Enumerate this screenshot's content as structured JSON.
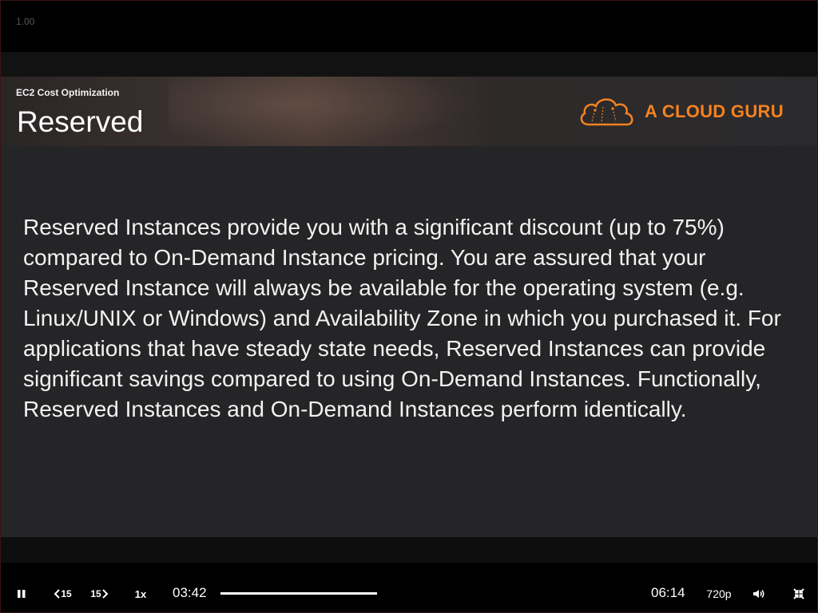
{
  "player": {
    "top_readout": "1.00"
  },
  "slide": {
    "course": "EC2 Cost Optimization",
    "title": "Reserved",
    "brand": {
      "name": "A CLOUD GURU",
      "color": "#f58220",
      "icon": "cloud-logo-icon"
    },
    "body": "Reserved Instances provide you with a significant discount (up to 75%) compared to On-Demand Instance pricing. You are assured that your Reserved Instance will always be available for the operating system (e.g. Linux/UNIX or Windows) and Availability Zone in which you purchased it. For applications that have steady state needs, Reserved Instances can provide significant savings compared to using On-Demand Instances. Functionally, Reserved Instances and On-Demand Instances perform identically."
  },
  "controls": {
    "pause_icon": "pause-icon",
    "rewind_icon": "rewind-15-icon",
    "rewind_label": "15",
    "forward_icon": "forward-15-icon",
    "forward_label": "15",
    "speed_label": "1x",
    "current_time": "03:42",
    "total_time": "06:14",
    "quality_label": "720p",
    "volume_icon": "volume-icon",
    "exit_fullscreen_icon": "exit-fullscreen-icon"
  }
}
